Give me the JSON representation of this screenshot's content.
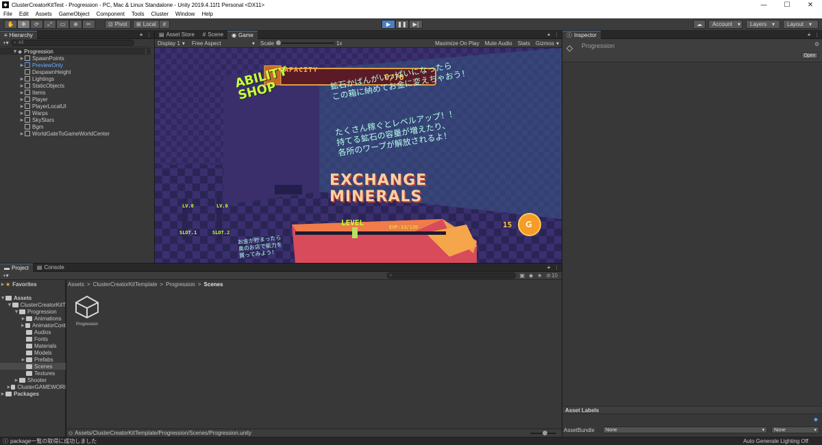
{
  "window": {
    "title": "ClusterCreatorKitTest - Progression - PC, Mac & Linux Standalone - Unity 2019.4.11f1 Personal <DX11>",
    "app_icon": "unity-icon",
    "minimize": "—",
    "maximize": "☐",
    "close": "✕"
  },
  "menu": [
    "File",
    "Edit",
    "Assets",
    "GameObject",
    "Component",
    "Tools",
    "Cluster",
    "Window",
    "Help"
  ],
  "toolbar": {
    "tools": [
      "hand-icon",
      "move-icon",
      "rotate-icon",
      "scale-icon",
      "rect-icon",
      "transform-icon",
      "custom-tool-icon"
    ],
    "tool_glyphs": [
      "✋",
      "✥",
      "⟳",
      "⤢",
      "▭",
      "⊕",
      "✂"
    ],
    "pivot": "Pivot",
    "local": "Local",
    "grid_glyph": "#",
    "play": "▶",
    "pause": "❚❚",
    "step": "▶|",
    "cloud_glyph": "☁",
    "account": "Account",
    "layers": "Layers",
    "layout": "Layout"
  },
  "hierarchy": {
    "tab": "Hierarchy",
    "add": "+▾",
    "search_placeholder": "All",
    "scene": "Progression",
    "items": [
      {
        "label": "SpawnPoints",
        "expandable": true,
        "blue": false
      },
      {
        "label": "PreviewOnly",
        "expandable": true,
        "blue": true
      },
      {
        "label": "DespawnHeight",
        "expandable": false,
        "blue": false
      },
      {
        "label": "Lightings",
        "expandable": true,
        "blue": false
      },
      {
        "label": "StaticObjects",
        "expandable": true,
        "blue": false
      },
      {
        "label": "Items",
        "expandable": true,
        "blue": false
      },
      {
        "label": "Player",
        "expandable": true,
        "blue": false
      },
      {
        "label": "PlayerLocalUI",
        "expandable": true,
        "blue": false
      },
      {
        "label": "Warps",
        "expandable": true,
        "blue": false
      },
      {
        "label": "SkyStars",
        "expandable": true,
        "blue": false
      },
      {
        "label": "Bgm",
        "expandable": false,
        "blue": false
      },
      {
        "label": "WorldGateToGameWorldCenter",
        "expandable": true,
        "blue": false
      }
    ]
  },
  "center_tabs": [
    "Asset Store",
    "Scene",
    "Game"
  ],
  "game_toolbar": {
    "display": "Display 1",
    "aspect": "Free Aspect",
    "scale_label": "Scale",
    "scale_value": "1x",
    "maximize": "Maximize On Play",
    "mute": "Mute Audio",
    "stats": "Stats",
    "gizmos": "Gizmos"
  },
  "game": {
    "shop_line1": "ABILITY",
    "shop_line2": "SHOP",
    "capacity_label": "CAPACITY",
    "capacity_value": "0/70",
    "jp_line1": "鉱石かばんがいっぱいになったら",
    "jp_line2": "この箱に納めてお金に変えちゃおう！",
    "jp_line3": "たくさん稼ぐとレベルアップ！！",
    "jp_line4": "持てる鉱石の容量が増えたり、",
    "jp_line5": "各所のワープが解放されるよ！",
    "exchange1": "EXCHANGE",
    "exchange2": "MINERALS",
    "slot_lv1": "LV.0",
    "slot_lv2": "LV.0",
    "slot1": "SLOT.1",
    "slot2": "SLOT.2",
    "level_label": "LEVEL",
    "exp": "EXP:13/120",
    "coins": "15",
    "coin_symbol": "G",
    "small_jp1": "お金が貯まったら",
    "small_jp2": "奥のお店で能力を",
    "small_jp3": "買ってみよう！"
  },
  "bottom_tabs": [
    "Project",
    "Console"
  ],
  "project": {
    "add": "+▾",
    "favorites": "Favorites",
    "assets": "Assets",
    "tree": [
      {
        "label": "ClusterCreatorKitT",
        "depth": 1,
        "arrow": "▼"
      },
      {
        "label": "Progression",
        "depth": 2,
        "arrow": "▼"
      },
      {
        "label": "Animations",
        "depth": 3,
        "arrow": "▶"
      },
      {
        "label": "AnimatorCont",
        "depth": 3,
        "arrow": "▶"
      },
      {
        "label": "Audios",
        "depth": 3,
        "arrow": ""
      },
      {
        "label": "Fonts",
        "depth": 3,
        "arrow": ""
      },
      {
        "label": "Materials",
        "depth": 3,
        "arrow": ""
      },
      {
        "label": "Models",
        "depth": 3,
        "arrow": ""
      },
      {
        "label": "Prefabs",
        "depth": 3,
        "arrow": "▶"
      },
      {
        "label": "Scenes",
        "depth": 3,
        "arrow": ""
      },
      {
        "label": "Textures",
        "depth": 3,
        "arrow": ""
      },
      {
        "label": "Shooter",
        "depth": 2,
        "arrow": "▶"
      },
      {
        "label": "ClusterGAMEWORI",
        "depth": 1,
        "arrow": "▶"
      }
    ],
    "packages": "Packages",
    "breadcrumb": [
      "Assets",
      "ClusterCreatorKitTemplate",
      "Progression",
      "Scenes"
    ],
    "breadcrumb_sep": ">",
    "asset_name": "Progression",
    "path": "Assets/ClusterCreatorKitTemplate/Progression/Scenes/Progression.unity",
    "hidden_count": "10"
  },
  "inspector": {
    "tab": "Inspector",
    "object": "Progression",
    "open": "Open",
    "asset_labels": "Asset Labels",
    "asset_bundle": "AssetBundle",
    "bundle_value": "None",
    "variant_value": "None"
  },
  "status": {
    "message": "package一覧の取得に成功しました",
    "right": "Auto Generate Lighting Off"
  }
}
